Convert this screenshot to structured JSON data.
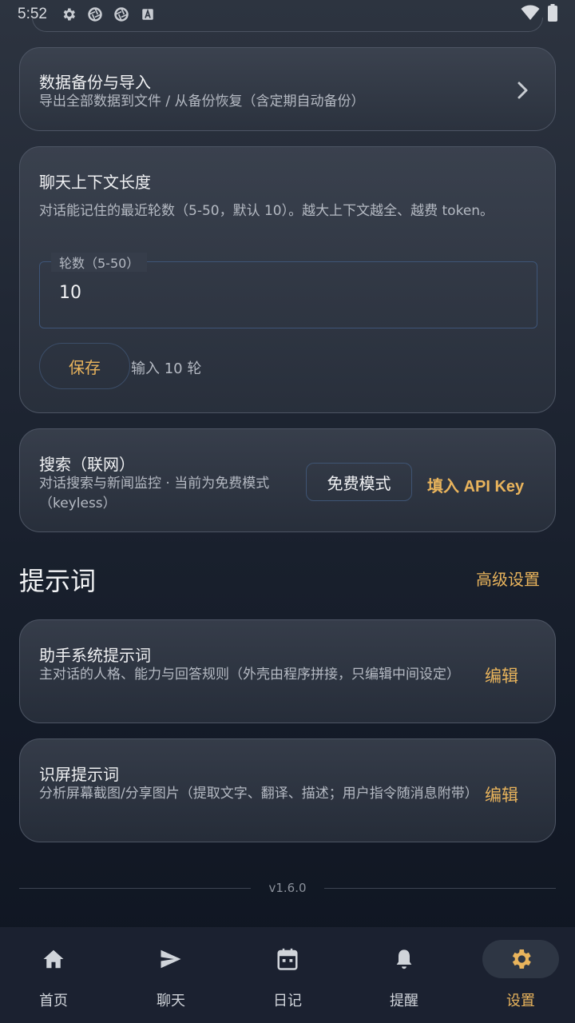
{
  "status_bar": {
    "time": "5:52",
    "icons": [
      "gear-icon",
      "aperture-icon",
      "aperture-icon",
      "a-box-icon"
    ],
    "right_icons": [
      "wifi-icon",
      "battery-icon"
    ]
  },
  "backup_card": {
    "title": "数据备份与导入",
    "description": "导出全部数据到文件 / 从备份恢复（含定期自动备份）",
    "icon": "chevron-right-icon"
  },
  "context_card": {
    "title": "聊天上下文长度",
    "description": "对话能记住的最近轮数（5-50，默认 10）。越大上下文越全、越费 token。",
    "field_label": "轮数（5-50）",
    "field_value": "10",
    "save_label": "保存",
    "save_hint": "输入 10 轮"
  },
  "search_card": {
    "title": "搜索（联网）",
    "description": "对话搜索与新闻监控 · 当前为免费模式（keyless）",
    "mode_button": "免费模式",
    "api_key_link": "填入 API Key"
  },
  "prompts_section": {
    "title": "提示词",
    "action": "高级设置",
    "items": [
      {
        "title": "助手系统提示词",
        "description": "主对话的人格、能力与回答规则（外壳由程序拼接，只编辑中间设定）",
        "edit_label": "编辑"
      },
      {
        "title": "识屏提示词",
        "description": "分析屏幕截图/分享图片（提取文字、翻译、描述；用户指令随消息附带）",
        "edit_label": "编辑"
      }
    ]
  },
  "version": "v1.6.0",
  "bottom_nav": {
    "items": [
      {
        "label": "首页",
        "icon": "home-icon"
      },
      {
        "label": "聊天",
        "icon": "send-icon"
      },
      {
        "label": "日记",
        "icon": "calendar-icon"
      },
      {
        "label": "提醒",
        "icon": "bell-icon"
      },
      {
        "label": "设置",
        "icon": "gear-icon"
      }
    ],
    "active": "设置"
  },
  "colors": {
    "accent": "#e9b45c",
    "background": "#1f2633",
    "card_border": "#4d5564",
    "field_border": "#3e5578"
  }
}
